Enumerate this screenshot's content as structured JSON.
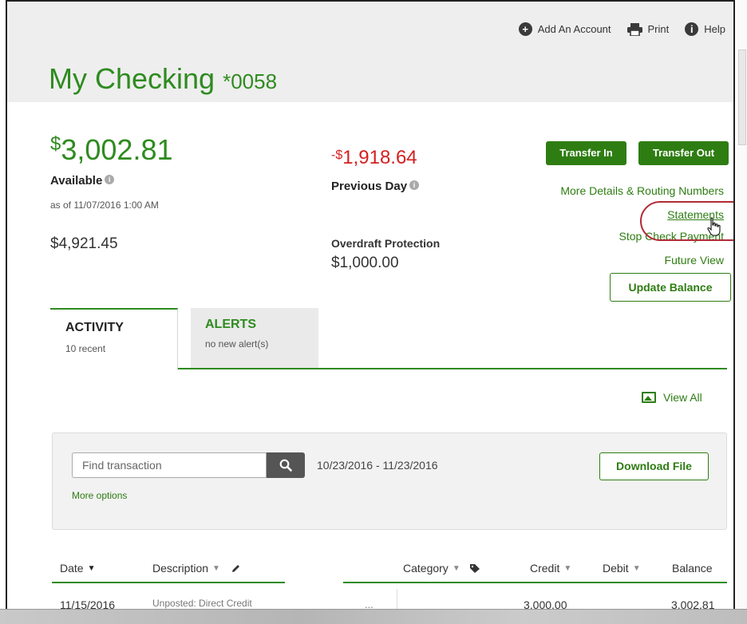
{
  "header": {
    "add_account": "Add An Account",
    "print": "Print",
    "help": "Help",
    "title": "My Checking",
    "account_number": "*0058"
  },
  "balances": {
    "available_symbol": "$",
    "available_amount": "3,002.81",
    "available_label": "Available",
    "as_of": "as of 11/07/2016 1:00 AM",
    "ledger": "$4,921.45",
    "previous_day_symbol": "-$",
    "previous_day_amount": "1,918.64",
    "previous_day_label": "Previous Day",
    "overdraft_label": "Overdraft Protection",
    "overdraft_amount": "$1,000.00"
  },
  "actions": {
    "transfer_in": "Transfer In",
    "transfer_out": "Transfer Out",
    "more_details": "More Details & Routing Numbers",
    "statements": "Statements",
    "stop_check": "Stop Check Payment",
    "future_view": "Future View",
    "update_balance": "Update Balance"
  },
  "tabs": [
    {
      "label": "ACTIVITY",
      "sub": "10 recent"
    },
    {
      "label": "ALERTS",
      "sub": "no new alert(s)"
    }
  ],
  "view_all": "View All",
  "filter": {
    "search_placeholder": "Find transaction",
    "date_range": "10/23/2016 - 11/23/2016",
    "more_options": "More options",
    "download": "Download File"
  },
  "table": {
    "columns": [
      "Date",
      "Description",
      "Category",
      "Credit",
      "Debit",
      "Balance"
    ],
    "rows": [
      {
        "date": "11/15/2016",
        "description": "Unposted: Direct Credit",
        "more": "...",
        "credit": "3,000.00",
        "debit": "",
        "balance": "3,002.81"
      }
    ]
  },
  "colors": {
    "brand_green": "#2e8b1f",
    "button_green": "#2e7d12",
    "negative_red": "#d42020",
    "highlight_circle": "#b22a35"
  }
}
